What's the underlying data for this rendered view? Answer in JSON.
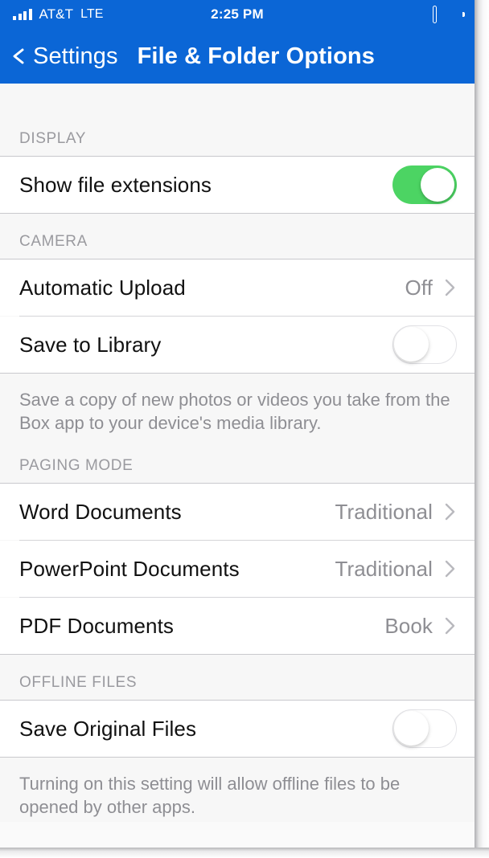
{
  "status_bar": {
    "carrier": "AT&T",
    "network": "LTE",
    "time": "2:25 PM",
    "signal_bars": 4,
    "battery_full": true
  },
  "nav": {
    "back_label": "Settings",
    "title": "File & Folder Options",
    "back_icon": "chevron-left-icon",
    "bar_color": "#0b66d6"
  },
  "colors": {
    "toggle_on": "#4cd463",
    "group_background": "#f7f7f7",
    "row_background": "#ffffff",
    "value_text": "#8e8e93",
    "header_text": "#9a9a9f"
  },
  "sections": [
    {
      "header": "DISPLAY",
      "rows": [
        {
          "label": "Show file extensions",
          "type": "toggle",
          "state": "on"
        }
      ],
      "footer": null
    },
    {
      "header": "CAMERA",
      "rows": [
        {
          "label": "Automatic Upload",
          "type": "disclosure",
          "value": "Off"
        },
        {
          "label": "Save to Library",
          "type": "toggle",
          "state": "off"
        }
      ],
      "footer": "Save a copy of new photos or videos you take from the Box app to your device's media library."
    },
    {
      "header": "PAGING MODE",
      "rows": [
        {
          "label": "Word Documents",
          "type": "disclosure",
          "value": "Traditional"
        },
        {
          "label": "PowerPoint Documents",
          "type": "disclosure",
          "value": "Traditional"
        },
        {
          "label": "PDF Documents",
          "type": "disclosure",
          "value": "Book"
        }
      ],
      "footer": null
    },
    {
      "header": "OFFLINE FILES",
      "rows": [
        {
          "label": "Save Original Files",
          "type": "toggle",
          "state": "off"
        }
      ],
      "footer": "Turning on this setting will allow offline files to be opened by other apps."
    }
  ]
}
